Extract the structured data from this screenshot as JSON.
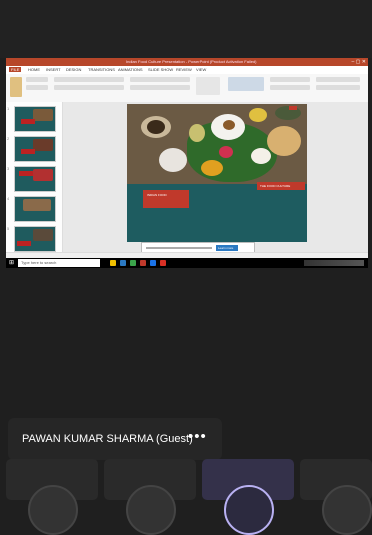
{
  "shared_screen": {
    "window_title": "Indian Food Culture Presentation - PowerPoint (Product Activation Failed)",
    "ribbon_tabs": [
      "FILE",
      "HOME",
      "INSERT",
      "DESIGN",
      "TRANSITIONS",
      "ANIMATIONS",
      "SLIDE SHOW",
      "REVIEW",
      "VIEW"
    ],
    "slide": {
      "title_text": "INDIAN FOOD",
      "subtitle_text": "THE FOOD CULTURE"
    },
    "notification_button": "Learn more",
    "taskbar_search": "Type here to search"
  },
  "participant": {
    "name": "PAWAN KUMAR SHARMA (Guest)",
    "more_label": "•••"
  },
  "colors": {
    "slide_bg": "#1e5c60",
    "accent_red": "#c0392b",
    "active_control": "#b9b1f2"
  }
}
